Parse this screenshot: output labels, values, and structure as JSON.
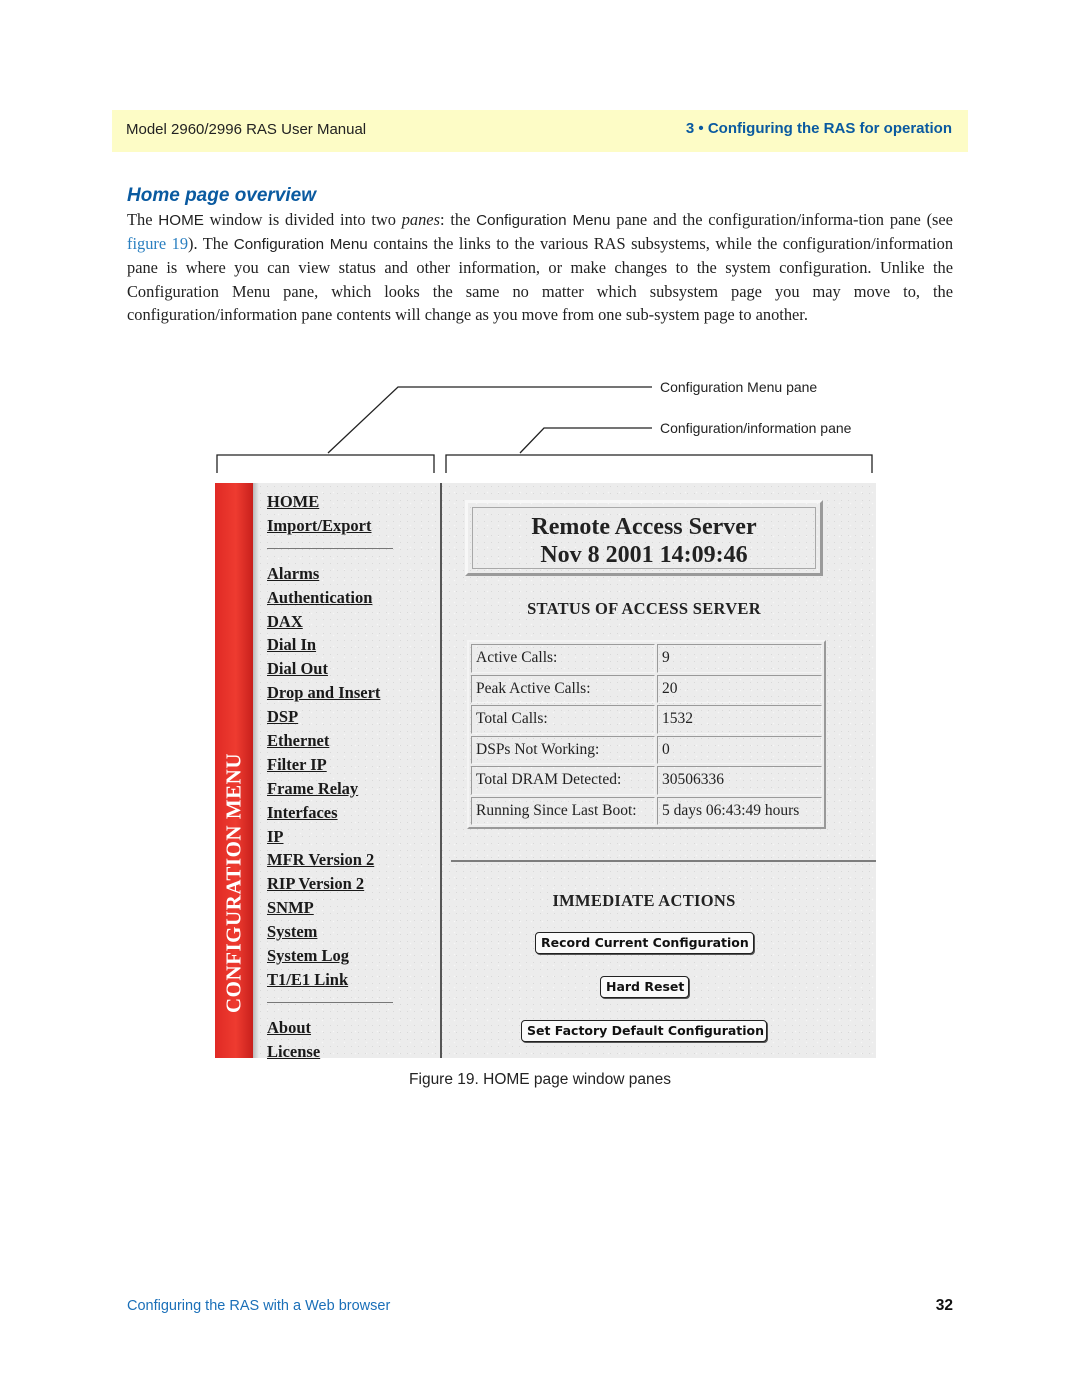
{
  "header": {
    "manual_title": "Model 2960/2996 RAS User Manual",
    "chapter": "3 • Configuring the RAS for operation"
  },
  "section": {
    "title": "Home page overview",
    "paragraph": {
      "p1": "The ",
      "p2_sans": "HOME",
      "p3": " window is divided into two ",
      "p4_italic": "panes",
      "p5": ": the ",
      "p6_sans": "Configuration Menu",
      "p7": " pane and the configuration/informa-tion pane (see ",
      "p8_link": "figure 19",
      "p9": "). The ",
      "p10_sans": "Configuration Menu",
      "p11": " contains the links to the various RAS subsystems, while the configuration/information pane is where you can view status and other information, or make changes to the system configuration. Unlike the Configuration Menu pane, which looks the same no matter which subsystem page you may move to, the configuration/information pane contents will change as you move from one sub-system page to another."
    }
  },
  "figure": {
    "callouts": {
      "menu_pane": "Configuration Menu pane",
      "info_pane": "Configuration/information pane"
    },
    "sidebar_banner": "CONFIGURATION MENU",
    "menu_groups": [
      [
        "HOME",
        "Import/Export"
      ],
      [
        "Alarms",
        "Authentication",
        "DAX",
        "Dial In",
        "Dial Out",
        "Drop and Insert",
        "DSP",
        "Ethernet",
        "Filter IP",
        "Frame Relay",
        "Interfaces",
        "IP",
        "MFR Version 2",
        "RIP Version 2",
        "SNMP",
        "System",
        "System Log",
        "T1/E1 Link"
      ],
      [
        "About",
        "License"
      ]
    ],
    "title_box": {
      "line1": "Remote Access Server",
      "line2": "Nov 8 2001 14:09:46"
    },
    "status_heading": "STATUS OF ACCESS SERVER",
    "status_rows": [
      {
        "label": "Active Calls:",
        "value": "9"
      },
      {
        "label": "Peak Active Calls:",
        "value": "20"
      },
      {
        "label": "Total Calls:",
        "value": "1532"
      },
      {
        "label": "DSPs Not Working:",
        "value": "0"
      },
      {
        "label": "Total DRAM Detected:",
        "value": "30506336"
      },
      {
        "label": "Running Since Last Boot:",
        "value": "5 days 06:43:49 hours"
      }
    ],
    "actions_heading": "IMMEDIATE ACTIONS",
    "buttons": {
      "record": "Record Current Configuration",
      "reset": "Hard Reset",
      "factory": "Set Factory Default Configuration"
    },
    "caption": "Figure 19. HOME page window panes"
  },
  "footer": {
    "section_link": "Configuring the RAS with a Web browser",
    "page_number": "32"
  }
}
